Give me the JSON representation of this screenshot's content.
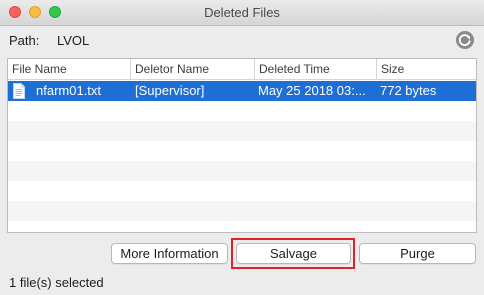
{
  "window": {
    "title": "Deleted Files"
  },
  "path": {
    "label": "Path:",
    "value": "LVOL"
  },
  "table": {
    "headers": [
      "File Name",
      "Deletor Name",
      "Deleted Time",
      "Size"
    ],
    "rows": [
      {
        "file_name": "nfarm01.txt",
        "deletor": "[Supervisor]",
        "deleted_time": "May 25 2018 03:...",
        "size": "772 bytes",
        "selected": true
      }
    ]
  },
  "buttons": {
    "more_info": "More Information",
    "salvage": "Salvage",
    "purge": "Purge"
  },
  "status": "1 file(s) selected",
  "colors": {
    "selection": "#1d6fd6",
    "highlight_box": "#e0202a",
    "close": "#fc605c",
    "minimize": "#fdbc40",
    "maximize": "#34c84a"
  },
  "icons": {
    "refresh": "refresh-icon",
    "file": "text-file-icon"
  }
}
